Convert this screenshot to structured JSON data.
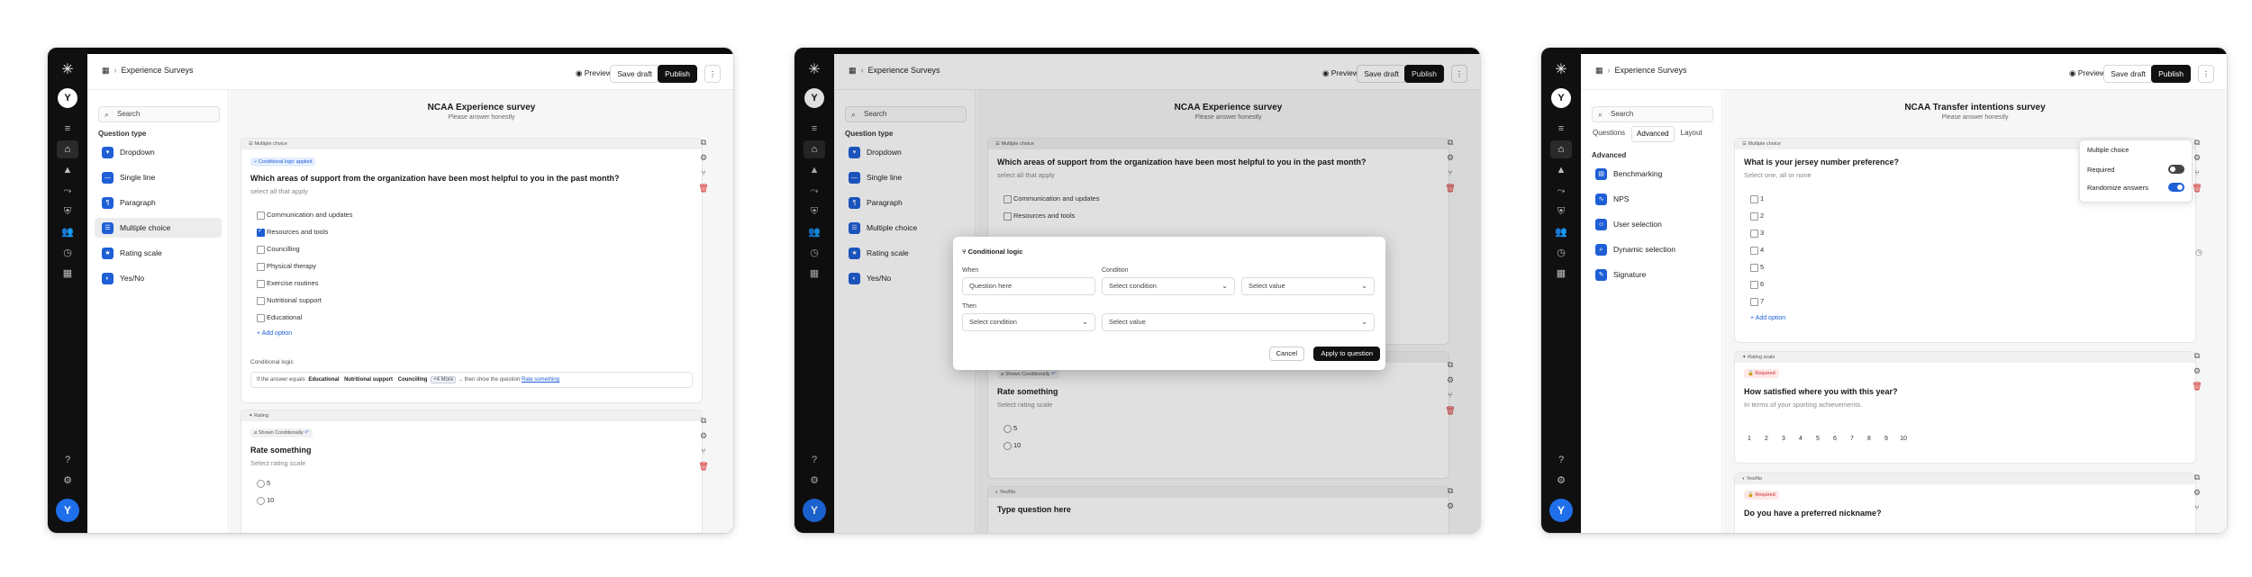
{
  "common": {
    "breadcrumb_icon": "grid-icon",
    "breadcrumb": "Experience Surveys",
    "preview": "Preview",
    "save_draft": "Save draft",
    "publish": "Publish",
    "search_placeholder": "Search",
    "question_type_label": "Question type",
    "question_types": [
      {
        "label": "Dropdown",
        "icon": "dropdown-icon"
      },
      {
        "label": "Single line",
        "icon": "single-line-icon"
      },
      {
        "label": "Paragraph",
        "icon": "paragraph-icon"
      },
      {
        "label": "Multiple choice",
        "icon": "multiple-choice-icon"
      },
      {
        "label": "Rating scale",
        "icon": "rating-icon"
      },
      {
        "label": "Yes/No",
        "icon": "yes-no-icon"
      }
    ],
    "accent_color": "#1f5fd6"
  },
  "screen1": {
    "survey_title": "NCAA Experience survey",
    "survey_subtitle": "Please answer honestly",
    "q1": {
      "type": "Multiple choice",
      "pill": "Conditional logic applied",
      "question": "Which areas of support from the organization have been most helpful to you in the past month?",
      "hint": "select all that apply",
      "options": [
        "Communication and updates",
        "Resources and tools",
        "Councilling",
        "Physical therapy",
        "Exercise routines",
        "Nutritional support",
        "Educational"
      ],
      "checked_index": 1,
      "add_option": "+ Add option",
      "logic_label": "Conditional logic",
      "logic": {
        "prefix": "If the answer equals",
        "tag1": "Educational",
        "tag2": "Nutritional support",
        "tag3": "Councilling",
        "more": "+4 More",
        "mid": "→ then show the question",
        "link": "Rate something"
      }
    },
    "q2": {
      "type": "Rating",
      "pill": "Shown Conditionally",
      "question": "Rate something",
      "hint": "Select rating scale",
      "options": [
        "5",
        "10"
      ]
    }
  },
  "screen2": {
    "survey_title": "NCAA Experience survey",
    "survey_subtitle": "Please answer honestly",
    "q1": {
      "type": "Multiple choice",
      "question": "Which areas of support from the organization have been most helpful to you in the past month?",
      "hint": "select all that apply",
      "options": [
        "Communication and updates",
        "Resources and tools"
      ]
    },
    "modal": {
      "title": "Conditional logic",
      "when_label": "When",
      "condition_label": "Condition",
      "question_placeholder": "Question here",
      "select_condition": "Select condition",
      "select_value": "Select value",
      "then_label": "Then",
      "cancel": "Cancel",
      "apply": "Apply to question"
    },
    "q2": {
      "pill": "Shown Conditionally",
      "question": "Rate something",
      "hint": "Select rating scale",
      "options": [
        "5",
        "10"
      ]
    },
    "q3": {
      "type": "Yes/No",
      "question": "Type question here"
    }
  },
  "screen3": {
    "survey_title": "NCAA Transfer intentions survey",
    "survey_subtitle": "Please answer honestly",
    "tabs": [
      "Questions",
      "Advanced",
      "Layout"
    ],
    "active_tab": 1,
    "advanced_label": "Advanced",
    "advanced_types": [
      {
        "label": "Benchmarking",
        "icon": "benchmark-icon"
      },
      {
        "label": "NPS",
        "icon": "nps-icon"
      },
      {
        "label": "User selection",
        "icon": "user-icon"
      },
      {
        "label": "Dynamic selection",
        "icon": "dynamic-icon"
      },
      {
        "label": "Signature",
        "icon": "signature-icon"
      }
    ],
    "q1": {
      "type": "Multiple choice",
      "question": "What is your jersey number preference?",
      "hint": "Select one, all or none",
      "options": [
        "1",
        "2",
        "3",
        "4",
        "5",
        "6",
        "7"
      ],
      "add_option": "+ Add option"
    },
    "popover": {
      "title": "Multiple choice",
      "required": "Required",
      "required_on": false,
      "randomize": "Randomize answers",
      "randomize_on": true
    },
    "q2": {
      "type": "Rating scale",
      "pill": "Required",
      "question": "How satisfied where you with this year?",
      "hint": "In terms of your sporting achievements.",
      "scale": [
        "1",
        "2",
        "3",
        "4",
        "5",
        "6",
        "7",
        "8",
        "9",
        "10"
      ]
    },
    "q3": {
      "type": "Yes/No",
      "pill": "Required",
      "question": "Do you have a preferred nickname?"
    }
  }
}
